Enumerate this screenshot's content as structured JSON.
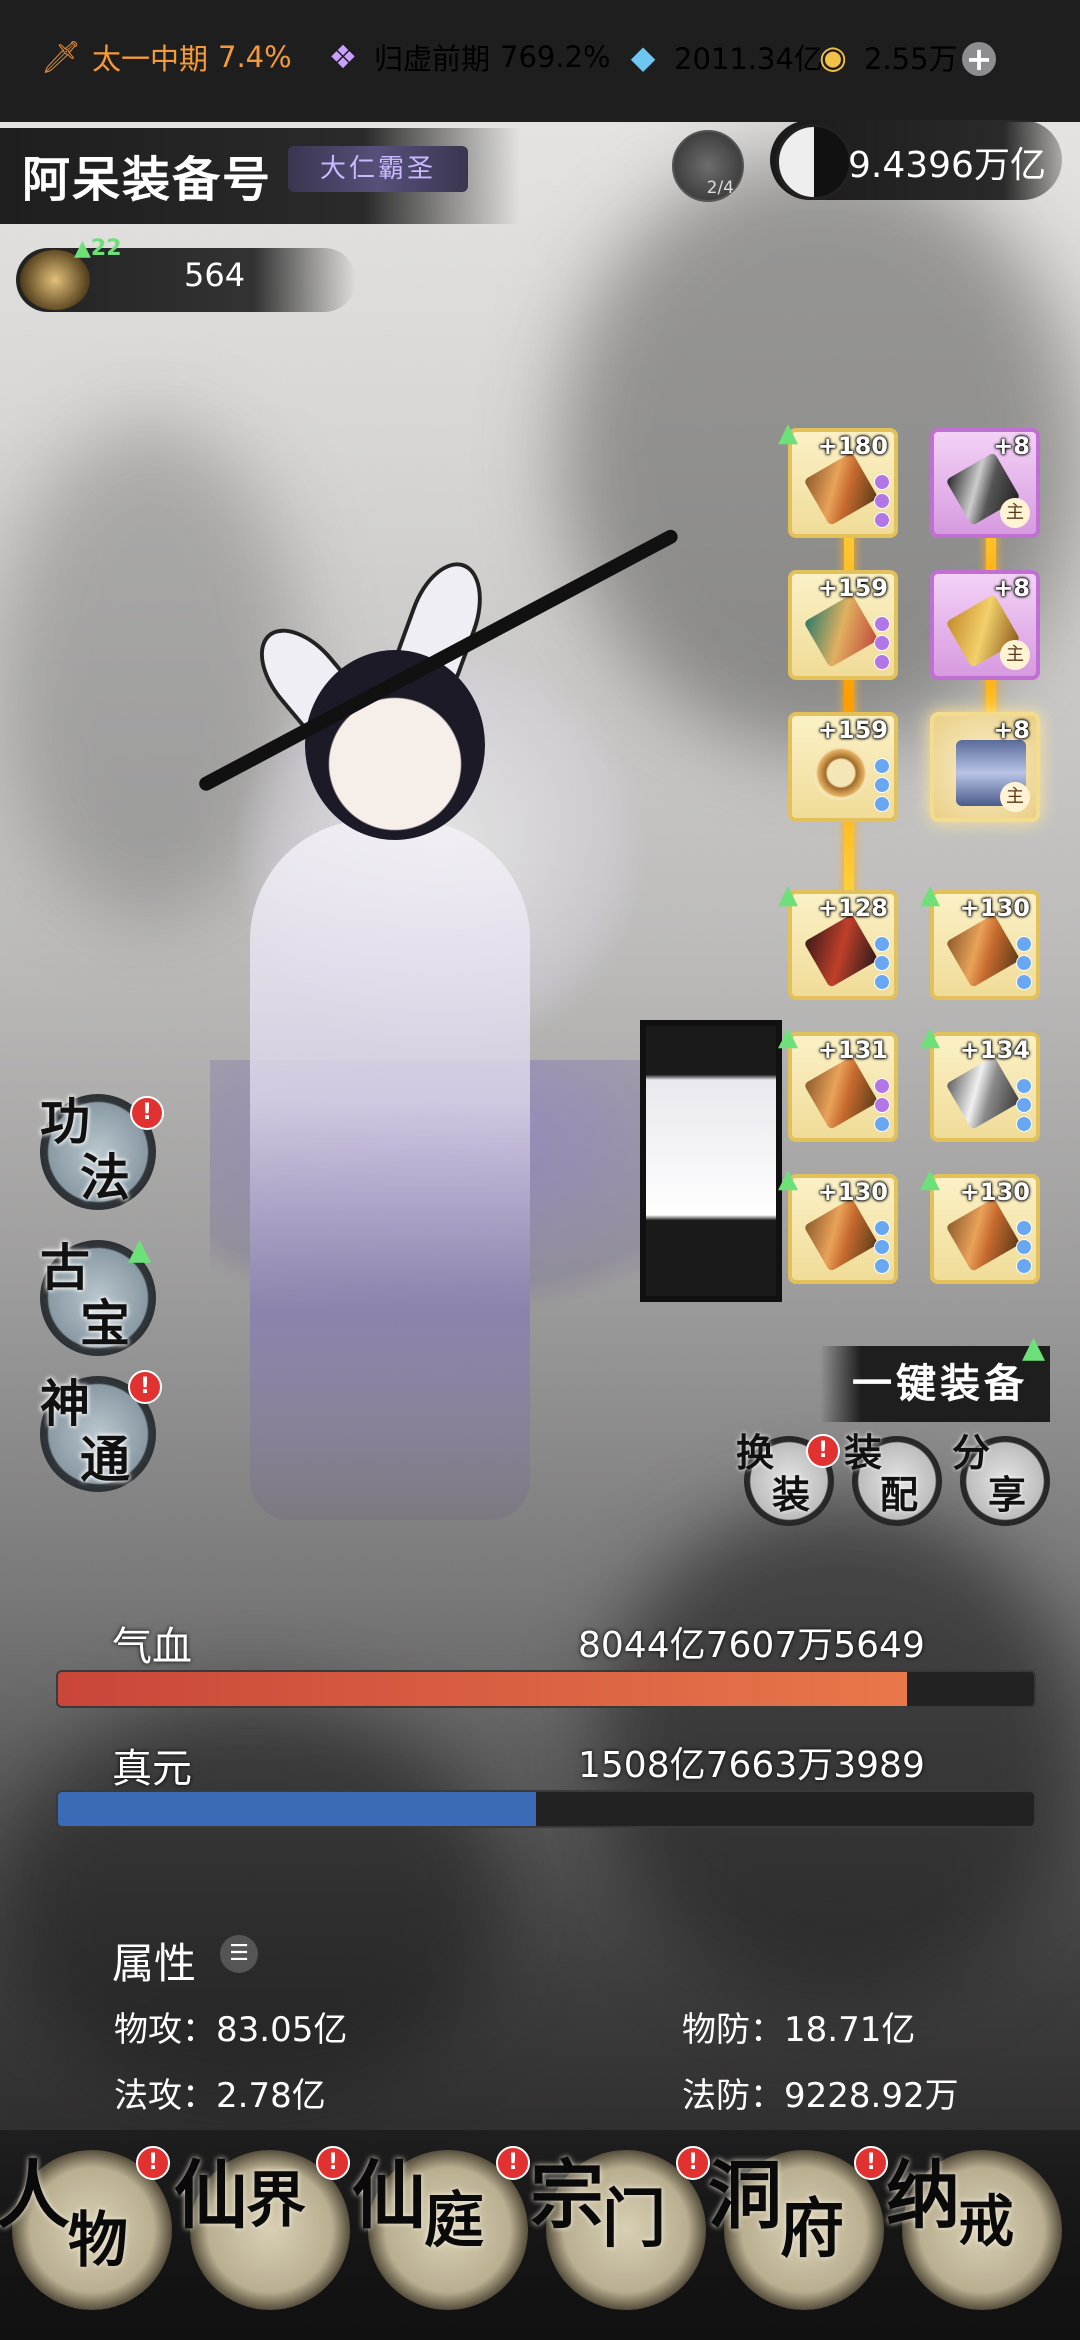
{
  "topbar": {
    "cultivation_realm": "太一中期",
    "cultivation_pct": "7.4%",
    "secondary_realm": "归虚前期",
    "secondary_pct": "769.2%",
    "spirit_stones": "2011.34亿",
    "gold": "2.55万"
  },
  "character": {
    "name": "阿呆装备号",
    "title": "大仁霸圣",
    "progress": "2/4",
    "combat_power": "9.4396万亿",
    "level_up": "22",
    "level_value": "564"
  },
  "equipment": [
    {
      "level": "+180",
      "main": ""
    },
    {
      "level": "+8",
      "main": "主"
    },
    {
      "level": "+159",
      "main": ""
    },
    {
      "level": "+8",
      "main": "主"
    },
    {
      "level": "+159",
      "main": ""
    },
    {
      "level": "+8",
      "main": "主"
    },
    {
      "level": "+128",
      "main": ""
    },
    {
      "level": "+130",
      "main": ""
    },
    {
      "level": "+131",
      "main": ""
    },
    {
      "level": "+134",
      "main": ""
    },
    {
      "level": "+130",
      "main": ""
    },
    {
      "level": "+130",
      "main": ""
    }
  ],
  "side_menu": [
    {
      "line1": "功",
      "line2": "法",
      "badge": "!"
    },
    {
      "line1": "古",
      "line2": "宝",
      "badge": ""
    },
    {
      "line1": "神",
      "line2": "通",
      "badge": "!"
    }
  ],
  "actions": {
    "one_key_equip": "一键装备",
    "swap": {
      "line1": "换",
      "line2": "装",
      "badge": "!"
    },
    "config": {
      "line1": "装",
      "line2": "配"
    },
    "share": {
      "line1": "分",
      "line2": "享"
    }
  },
  "vitals": {
    "hp_label": "气血",
    "hp_value": "8044亿7607万5649",
    "hp_fill": 0.87,
    "hp_color": "#c9463a",
    "mp_label": "真元",
    "mp_value": "1508亿7663万3989",
    "mp_fill": 0.49,
    "mp_color": "#3b6bb7"
  },
  "attributes": {
    "title": "属性",
    "phys_atk": "物攻：83.05亿",
    "phys_def": "物防：18.71亿",
    "mag_atk": "法攻：2.78亿",
    "mag_def": "法防：9228.92万"
  },
  "nav": [
    {
      "a": "人",
      "b": "物",
      "badge": "!"
    },
    {
      "a": "仙",
      "b": "界",
      "badge": "!"
    },
    {
      "a": "仙",
      "b": "庭",
      "badge": "!"
    },
    {
      "a": "宗",
      "b": "门",
      "badge": "!"
    },
    {
      "a": "洞",
      "b": "府",
      "badge": "!"
    },
    {
      "a": "纳",
      "b": "戒",
      "badge": ""
    }
  ],
  "icons": {
    "realm": "sword-icon",
    "secondary": "spirit-icon",
    "stones": "crystal-icon",
    "gold": "coin-icon",
    "add": "plus-icon"
  }
}
